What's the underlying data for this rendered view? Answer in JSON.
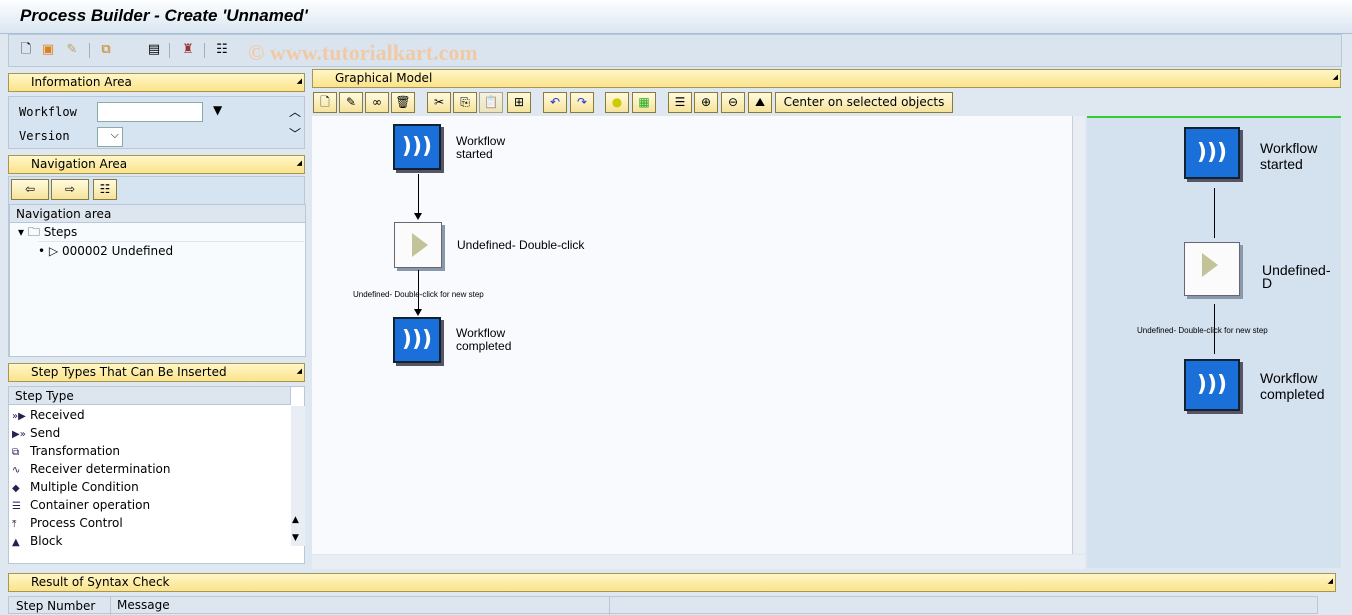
{
  "window": {
    "title": "Process Builder - Create 'Unnamed'"
  },
  "watermark": "© www.tutorialkart.com",
  "info_area": {
    "header": "Information Area",
    "workflow_label": "Workflow",
    "workflow_value": "",
    "version_label": "Version",
    "version_value": ""
  },
  "navigation": {
    "header": "Navigation Area",
    "tree_header": "Navigation area",
    "folder": "Steps",
    "item": "000002 Undefined"
  },
  "step_types": {
    "header": "Step Types That Can Be Inserted",
    "column": "Step Type",
    "items": [
      {
        "label": "Received",
        "icon": "received-icon"
      },
      {
        "label": "Send",
        "icon": "send-icon"
      },
      {
        "label": "Transformation",
        "icon": "transformation-icon"
      },
      {
        "label": "Receiver determination",
        "icon": "receiver-determination-icon"
      },
      {
        "label": "Multiple Condition",
        "icon": "multiple-condition-icon"
      },
      {
        "label": "Container operation",
        "icon": "container-operation-icon"
      },
      {
        "label": "Process Control",
        "icon": "process-control-icon"
      },
      {
        "label": "Block",
        "icon": "block-icon"
      }
    ]
  },
  "graphical_model": {
    "header": "Graphical Model",
    "center_button": "Center on selected objects",
    "nodes": {
      "start": "Workflow\nstarted",
      "undefined": "Undefined- Double-click",
      "end": "Workflow\ncompleted"
    },
    "edge_label": "Undefined- Double-click for new step",
    "overview_undefined": "Undefined- D"
  },
  "syntax_check": {
    "header": "Result of Syntax Check",
    "columns": [
      "Step Number",
      "Message"
    ]
  },
  "colors": {
    "header_yellow": "#fbe38a",
    "node_blue": "#1a6fd8",
    "panel_bg": "#d6e3f0"
  }
}
